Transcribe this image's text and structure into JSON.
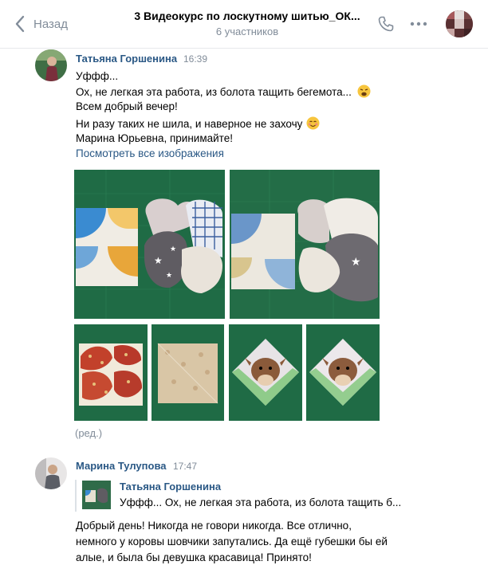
{
  "header": {
    "back_label": "Назад",
    "title": "3 Видеокурс по лоскутному шитью_ОК...",
    "subtitle": "6 участников"
  },
  "messages": [
    {
      "author": "Татьяна Горшенина",
      "time": "16:39",
      "lines": [
        "Уффф...",
        "Ох, не легкая эта работа, из болота тащить бегемота...",
        "Всем добрый вечер!",
        "Ни разу таких не шила, и наверное не захочу",
        "Марина Юрьевна, принимайте!"
      ],
      "view_all_link": "Посмотреть все изображения",
      "edited": "(ред.)"
    },
    {
      "author": "Марина Тулупова",
      "time": "17:47",
      "reply": {
        "author": "Татьяна Горшенина",
        "text": "Уффф... Ох, не легкая эта работа, из болота тащить б..."
      },
      "lines": [
        "Добрый день! Никогда не говори никогда. Все отлично,",
        "немного у коровы шовчики запутались. Да ещё губешки бы ей",
        "алые, и была бы девушка красавица! Принято!"
      ]
    }
  ],
  "icons": {
    "back": "chevron-left-icon",
    "call": "phone-icon",
    "menu": "more-dots-icon",
    "weary_face": "weary-face-emoji",
    "blush_face": "smiling-face-emoji"
  },
  "colors": {
    "link": "#2a5885",
    "secondary": "#818c99",
    "mat_green": "#1f6b45"
  }
}
